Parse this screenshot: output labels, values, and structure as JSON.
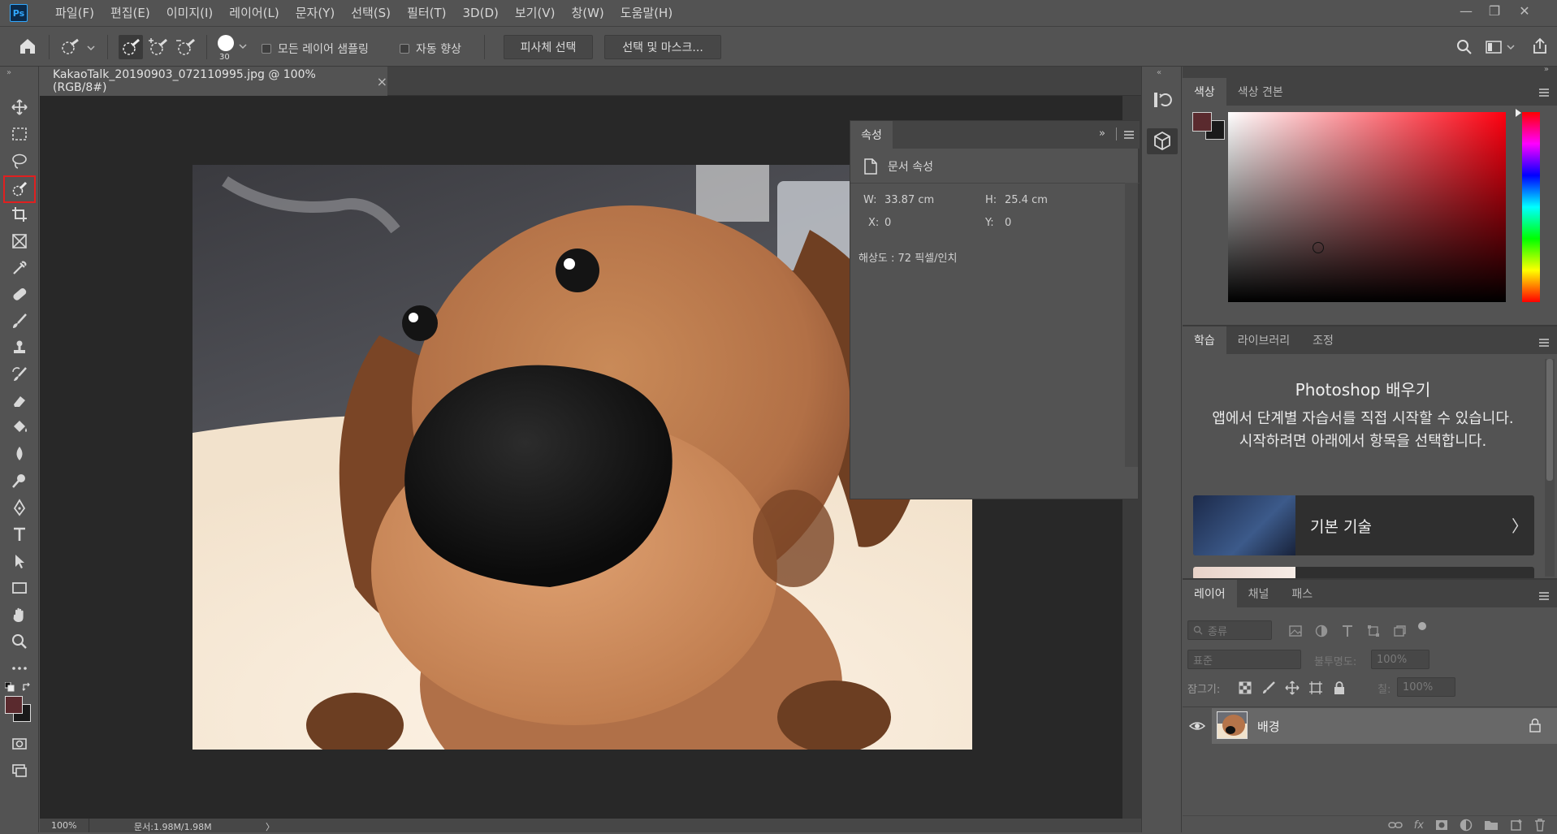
{
  "app": {
    "logo": "Ps"
  },
  "menu": [
    "파일(F)",
    "편집(E)",
    "이미지(I)",
    "레이어(L)",
    "문자(Y)",
    "선택(S)",
    "필터(T)",
    "3D(D)",
    "보기(V)",
    "창(W)",
    "도움말(H)"
  ],
  "window_controls": {
    "minimize": "—",
    "restore": "❐",
    "close": "✕"
  },
  "options": {
    "brush_size": "30",
    "sample_all_layers": "모든 레이어 샘플링",
    "auto_enhance": "자동 향상",
    "select_subject": "피사체 선택",
    "select_and_mask": "선택 및 마스크..."
  },
  "document": {
    "tab_title": "KakaoTalk_20190903_072110995.jpg @ 100% (RGB/8#)",
    "tab_close": "×",
    "zoom": "100%",
    "doc_info": "문서:1.98M/1.98M",
    "status_arrow": "〉"
  },
  "properties": {
    "tab": "속성",
    "section_title": "문서 속성",
    "w_label": "W:",
    "w_value": "33.87 cm",
    "h_label": "H:",
    "h_value": "25.4 cm",
    "x_label": "X:",
    "x_value": "0",
    "y_label": "Y:",
    "y_value": "0",
    "resolution": "해상도 : 72 픽셀/인치"
  },
  "color_panel": {
    "tabs": [
      "색상",
      "색상 견본"
    ],
    "foreground": "#5a2a2e",
    "background": "#1a1a1a",
    "hue_marker_color": "#ff0000"
  },
  "learn_panel": {
    "tabs": [
      "학습",
      "라이브러리",
      "조정"
    ],
    "heading": "Photoshop 배우기",
    "description": "앱에서 단계별 자습서를 직접 시작할 수 있습니다. 시작하려면 아래에서 항목을 선택합니다.",
    "card_label": "기본 기술",
    "card_arrow": "〉"
  },
  "layers_panel": {
    "tabs": [
      "레이어",
      "채널",
      "패스"
    ],
    "filter_kind": "종류",
    "blend_mode": "표준",
    "opacity_label": "불투명도:",
    "opacity_value": "100%",
    "lock_label": "잠그기:",
    "fill_label": "칠:",
    "fill_value": "100%",
    "layers": [
      {
        "name": "배경",
        "visible": true,
        "locked": true
      }
    ],
    "footer_fx": "fx"
  }
}
